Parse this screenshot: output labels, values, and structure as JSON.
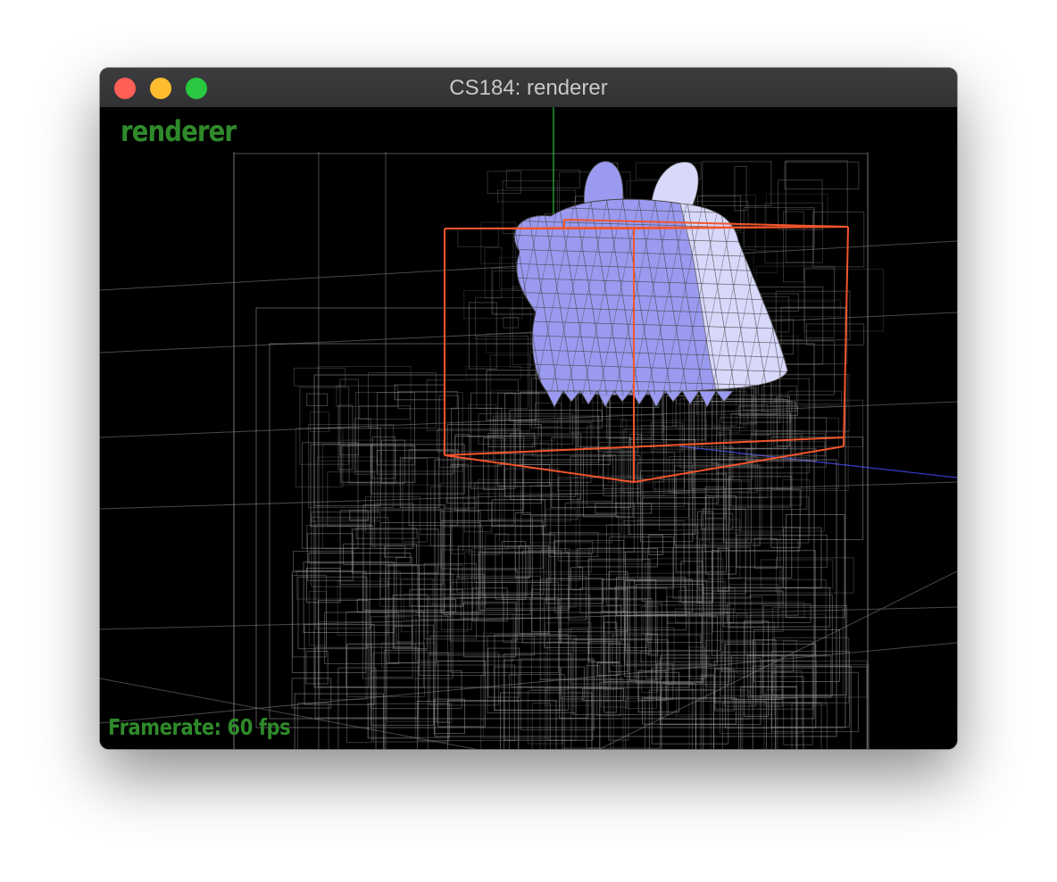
{
  "window": {
    "title": "CS184: renderer",
    "traffic_lights": {
      "close_color": "#fe5f57",
      "minimize_color": "#febc2e",
      "zoom_color": "#28c840"
    }
  },
  "viewport": {
    "app_label": "renderer",
    "framerate_label": "Framerate: 60 fps",
    "colors": {
      "background": "#000000",
      "overlay_text": "#2f8a2a",
      "selected_bbox": "#f2552c",
      "mesh_fill": "#9a9af0",
      "mesh_highlight": "#d8d8fa",
      "bvh_lines": "#9a9a9a",
      "grid_lines": "#5a5a5a",
      "axis_y": "#1fbf3a",
      "axis_z": "#3a3ad0"
    },
    "icons": [
      "close-traffic-light",
      "minimize-traffic-light",
      "zoom-traffic-light"
    ]
  }
}
